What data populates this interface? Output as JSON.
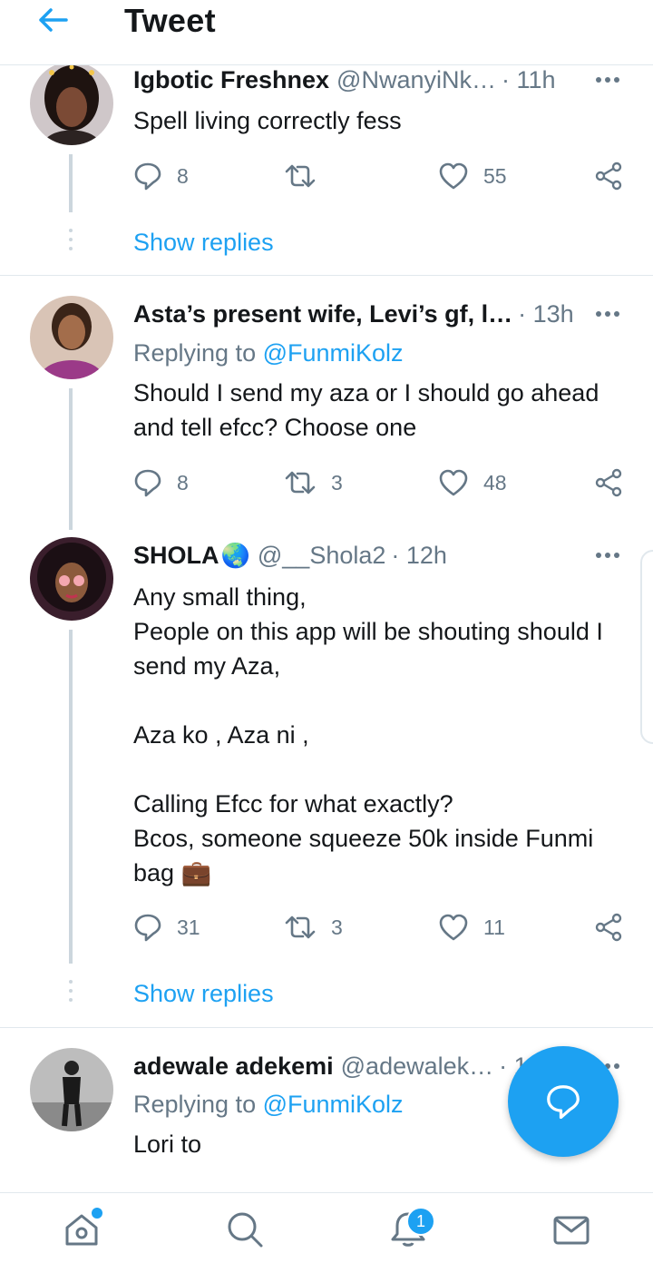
{
  "header": {
    "title": "Tweet"
  },
  "tweets": [
    {
      "name": "Igbotic Freshnex",
      "handle": "@NwanyiNk…",
      "time": "· 11h",
      "text": "Spell living correctly fess",
      "replies": "8",
      "retweets": "",
      "likes": "55",
      "show_replies": "Show replies"
    },
    {
      "name": "Asta’s present wife, Levi’s gf, l…",
      "handle": "",
      "time": "· 13h",
      "replying_prefix": "Replying to ",
      "replying_to": "@FunmiKolz",
      "text": "Should I send my aza or I should go ahead\nand tell efcc? Choose one",
      "replies": "8",
      "retweets": "3",
      "likes": "48"
    },
    {
      "name": "SHOLA",
      "name_emoji": "🌏",
      "handle": "@__Shola2",
      "time": "· 12h",
      "text": "Any small thing,\nPeople on this app will be shouting should I\nsend my Aza,\n\nAza ko , Aza ni ,\n\nCalling Efcc for what exactly?\nBcos, someone squeeze 50k inside Funmi\nbag",
      "text_emoji": "💼",
      "replies": "31",
      "retweets": "3",
      "likes": "11",
      "show_replies": "Show replies"
    },
    {
      "name": "adewale adekemi",
      "handle": "@adewalek…",
      "time": "· 1",
      "replying_prefix": "Replying to ",
      "replying_to": "@FunmiKolz",
      "text": "Lori to"
    }
  ],
  "notifications": {
    "badge": "1"
  },
  "colors": {
    "accent": "#1da1f2",
    "muted": "#657786",
    "text": "#14171a",
    "border": "#e1e8ed"
  },
  "icons": [
    "back-arrow-icon",
    "more-icon",
    "reply-icon",
    "retweet-icon",
    "like-icon",
    "share-icon",
    "compose-reply-icon",
    "home-icon",
    "search-icon",
    "bell-icon",
    "mail-icon"
  ]
}
